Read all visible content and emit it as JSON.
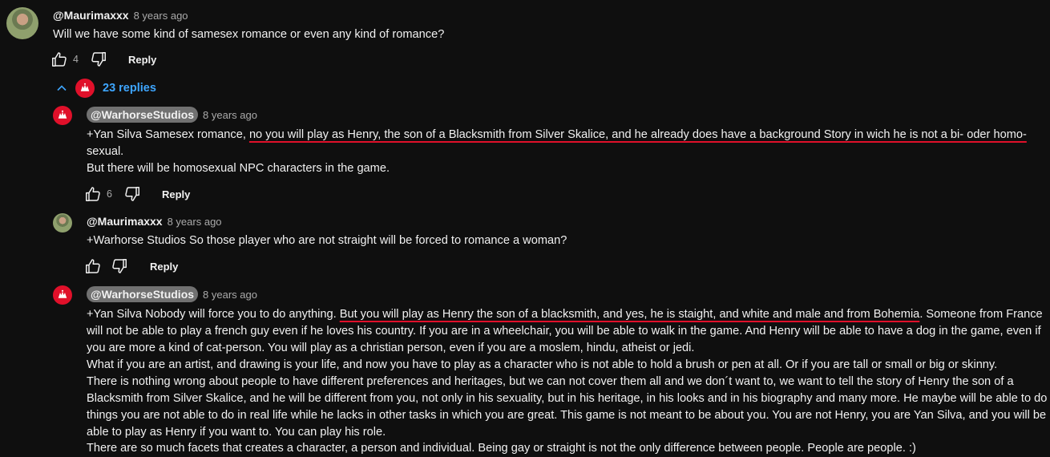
{
  "comment": {
    "handle": "@Maurimaxxx",
    "time": "8 years ago",
    "text": "Will we have some kind of samesex romance or even any kind of romance?",
    "likes": "4",
    "reply_label": "Reply"
  },
  "replies_toggle": {
    "label": "23 replies"
  },
  "replies": [
    {
      "handle": "@WarhorseStudios",
      "time": "8 years ago",
      "line1_pre": "+Yan Silva Samesex romance, ",
      "line1_ul": "no you will play as Henry, the son of a Blacksmith from Silver Skalice, and he already does have a background Story in wich he is not a bi- oder homo-",
      "line2": "sexual.",
      "line3": "But there will be homosexual NPC characters in the game.",
      "likes": "6",
      "reply_label": "Reply"
    },
    {
      "handle": "@Maurimaxxx",
      "time": "8 years ago",
      "line1": "+Warhorse Studios So those player who are not straight will be forced to romance a woman?",
      "reply_label": "Reply"
    },
    {
      "handle": "@WarhorseStudios",
      "time": "8 years ago",
      "line1_pre": "+Yan Silva Nobody will force you to do anything. ",
      "line1_ul": "But you will play as Henry the son of a blacksmith, and yes, he is staight, and white and male and from Bohemia",
      "line1_post": ". Someone from France",
      "line2": "will not be able to play a french guy even if he loves his country. If you are in a wheelchair, you will be able to walk in the game. And Henry will be able to have a dog in the game, even if",
      "line3": "you are more a kind of cat-person. You will play as a christian person, even if you are a moslem, hindu, atheist or jedi.",
      "line4": "What if you are an artist, and drawing is your life, and now you have to play as a character who is not able to hold a brush or pen at all. Or if you are tall or small or big or skinny.",
      "line5": "There is nothing wrong about people to have different preferences and heritages, but we can not cover them all and we don´t want to, we want to tell the story of Henry the son of a",
      "line6": "Blacksmith from Silver Skalice, and he will be different from you, not only in his sexuality, but in his heritage, in his looks and in his biography and many more. He maybe will be able to do",
      "line7": "things you are not able to do in real life while he lacks in other tasks in which you are great. This game is not meant to be about you. You are not Henry, you are Yan Silva, and you will be",
      "line8": "able to play as Henry if you want to. You can play his role.",
      "line9": "There are so much facets that creates a character, a person and individual. Being gay or straight is not the only difference between people. People are people. :)"
    }
  ],
  "colors": {
    "background": "#0f0f0f",
    "link_blue": "#3ea6ff",
    "underline_red": "#e0102a",
    "brand_red": "#e0102a"
  },
  "icons": [
    "thumb-up-icon",
    "thumb-down-icon",
    "chevron-up-icon",
    "warhorse-logo"
  ]
}
